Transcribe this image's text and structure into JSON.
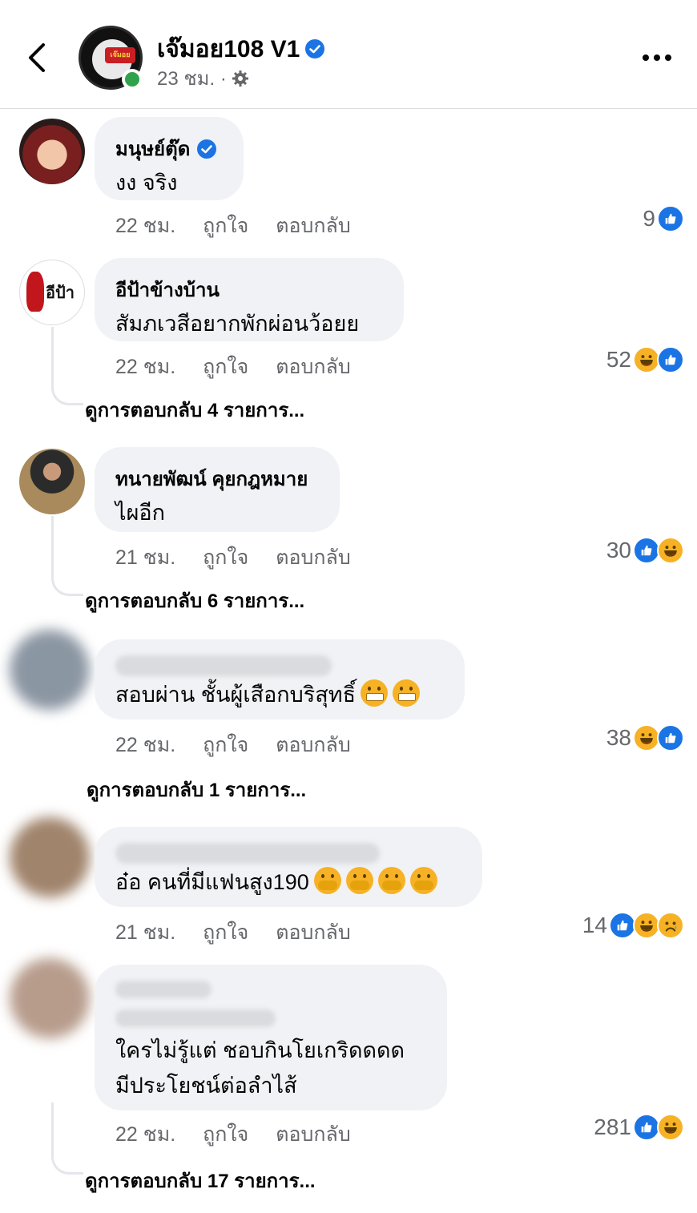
{
  "header": {
    "page_name": "เจ๊มอย108 V1",
    "time": "23 ชม.",
    "separator": "·",
    "logo_text": "เจ๊มอย"
  },
  "comments": [
    {
      "author": "มนุษย์ตุ๊ด",
      "verified": true,
      "text": "งง จริง",
      "time": "22 ชม.",
      "like_label": "ถูกใจ",
      "reply_label": "ตอบกลับ",
      "reaction_count": "9",
      "reactions": [
        "like"
      ]
    },
    {
      "author": "อีป้าข้างบ้าน",
      "text": "สัมภเวสีอยากพักผ่อนว้อยย",
      "avatar_text": "อีป้า",
      "time": "22 ชม.",
      "like_label": "ถูกใจ",
      "reply_label": "ตอบกลับ",
      "reaction_count": "52",
      "reactions": [
        "haha",
        "like"
      ],
      "view_replies": "ดูการตอบกลับ 4 รายการ..."
    },
    {
      "author": "ทนายพัฒน์ คุยกฎหมาย",
      "text": "ไผอีก",
      "time": "21 ชม.",
      "like_label": "ถูกใจ",
      "reply_label": "ตอบกลับ",
      "reaction_count": "30",
      "reactions": [
        "like",
        "haha"
      ],
      "view_replies": "ดูการตอบกลับ 6 รายการ..."
    },
    {
      "text": "สอบผ่าน ชั้นผู้เสือกบริสุทธิ์",
      "time": "22 ชม.",
      "like_label": "ถูกใจ",
      "reply_label": "ตอบกลับ",
      "reaction_count": "38",
      "reactions": [
        "haha",
        "like"
      ],
      "view_replies": "ดูการตอบกลับ 1 รายการ..."
    },
    {
      "text": "อ๋อ คนที่มีแฟนสูง190",
      "time": "21 ชม.",
      "like_label": "ถูกใจ",
      "reply_label": "ตอบกลับ",
      "reaction_count": "14",
      "reactions": [
        "like",
        "haha",
        "sad"
      ]
    },
    {
      "text_line1": "ใครไม่รู้แต่ ชอบกินโยเกริดดดด",
      "text_line2": "มีประโยชน์ต่อลำไส้",
      "time": "22 ชม.",
      "like_label": "ถูกใจ",
      "reply_label": "ตอบกลับ",
      "reaction_count": "281",
      "reactions": [
        "like",
        "haha"
      ],
      "view_replies": "ดูการตอบกลับ 17 รายการ..."
    }
  ],
  "colors": {
    "bubble": "#f0f2f5",
    "secondary_text": "#65676b",
    "like_blue": "#1b74e4",
    "emoji_yellow": "#f7b125",
    "online_green": "#31a24c"
  }
}
